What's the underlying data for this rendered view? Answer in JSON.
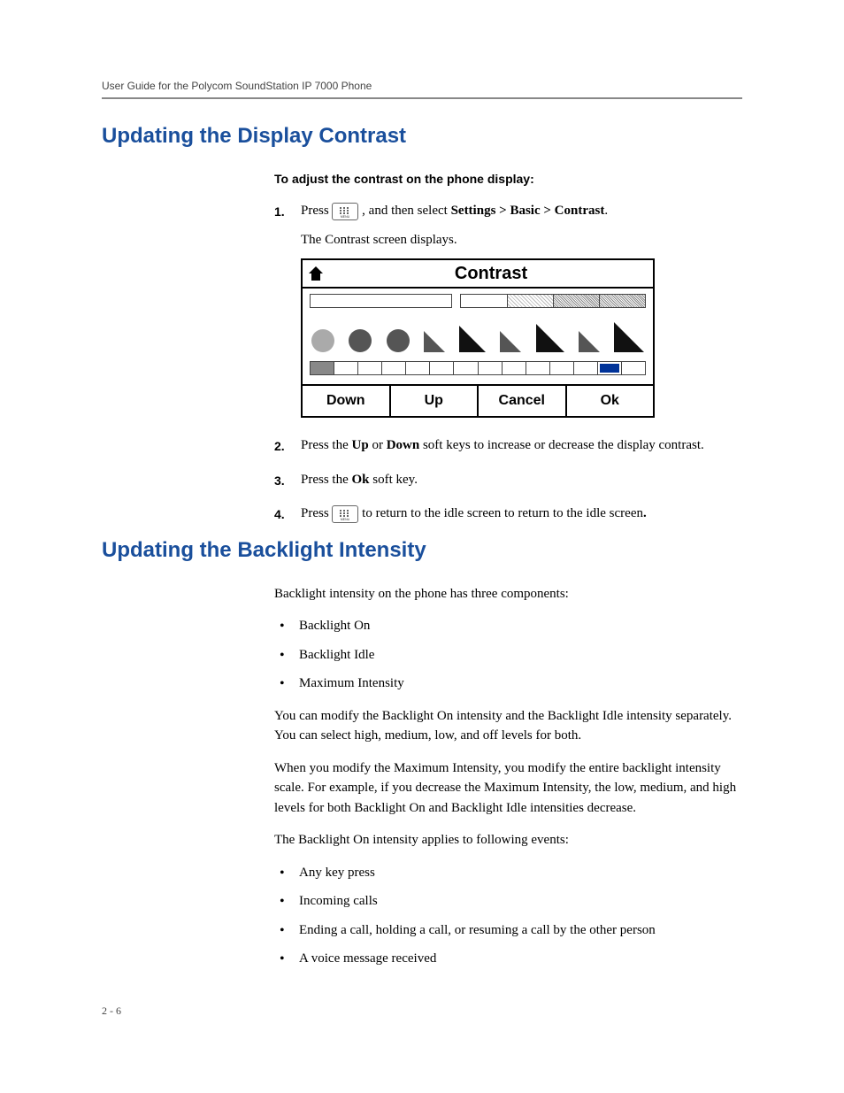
{
  "header": {
    "running": "User Guide for the Polycom SoundStation IP 7000 Phone"
  },
  "section1": {
    "title": "Updating the Display Contrast",
    "intro": "To adjust the contrast on the phone display:",
    "steps": {
      "n1": "1.",
      "s1a": "Press ",
      "s1b": ", and then select ",
      "s1c": "Settings > Basic > Contrast",
      "s1d": ".",
      "s1e": "The Contrast screen displays.",
      "n2": "2.",
      "s2a": "Press the ",
      "s2b": "Up",
      "s2c": " or ",
      "s2d": "Down",
      "s2e": " soft keys to increase or decrease the display contrast.",
      "n3": "3.",
      "s3a": "Press the ",
      "s3b": "Ok",
      "s3c": " soft key.",
      "n4": "4.",
      "s4a": "Press ",
      "s4b": " to return to the idle screen",
      "s4c": "."
    }
  },
  "figure": {
    "title": "Contrast",
    "softkeys": {
      "down": "Down",
      "up": "Up",
      "cancel": "Cancel",
      "ok": "Ok"
    }
  },
  "section2": {
    "title": "Updating the Backlight Intensity",
    "p1": "Backlight intensity on the phone has three components:",
    "bullets1": {
      "b1": "Backlight On",
      "b2": "Backlight Idle",
      "b3": "Maximum Intensity"
    },
    "p2": "You can modify the Backlight On intensity and the Backlight Idle intensity separately. You can select high, medium, low, and off levels for both.",
    "p3": "When you modify the Maximum Intensity, you modify the entire backlight intensity scale. For example, if you decrease the Maximum Intensity, the low, medium, and high levels for both Backlight On and Backlight Idle intensities decrease.",
    "p4": "The Backlight On intensity applies to following events:",
    "bullets2": {
      "b1": "Any key press",
      "b2": "Incoming calls",
      "b3": "Ending a call, holding a call, or resuming a call by the other person",
      "b4": "A voice message received"
    }
  },
  "footer": {
    "pagenum": "2 - 6"
  }
}
